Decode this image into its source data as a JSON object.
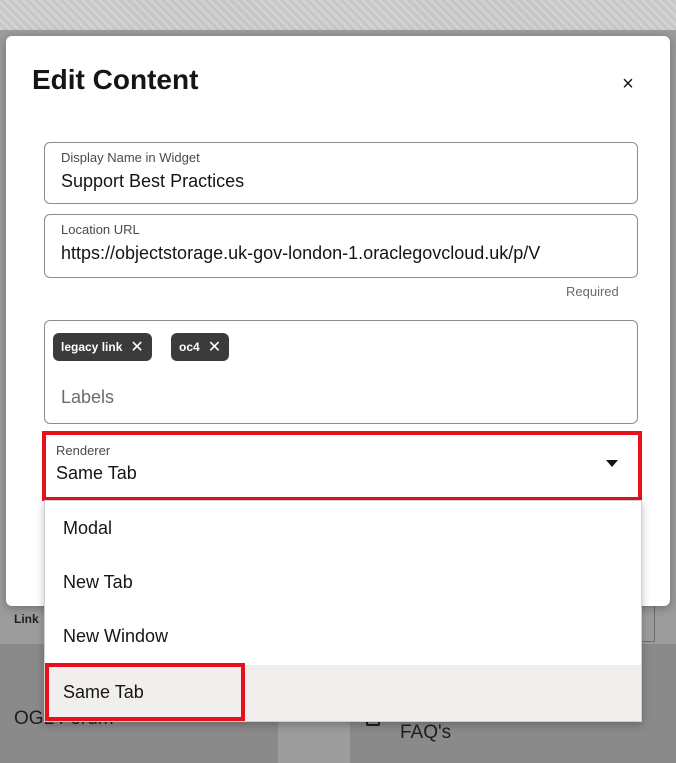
{
  "background": {
    "links_label": "Link",
    "card_left_text": "OGL Forum",
    "card_right_text": "FAQ's"
  },
  "dialog": {
    "title": "Edit Content",
    "close_glyph": "×",
    "display_name": {
      "label": "Display Name in Widget",
      "value": "Support Best Practices"
    },
    "location_url": {
      "label": "Location URL",
      "value": "https://objectstorage.uk-gov-london-1.oraclegovcloud.uk/p/V",
      "required_note": "Required"
    },
    "labels": {
      "chips": [
        {
          "text": "legacy link",
          "remove_glyph": "✕"
        },
        {
          "text": "oc4",
          "remove_glyph": "✕"
        }
      ],
      "placeholder": "Labels"
    },
    "renderer": {
      "label": "Renderer",
      "value": "Same Tab",
      "options": [
        "Modal",
        "New Tab",
        "New Window",
        "Same Tab"
      ]
    }
  },
  "colors": {
    "highlight": "#e8101b",
    "chip_bg": "#3c3b39",
    "selected_option_bg": "#f1efed"
  },
  "icons": {
    "close": "close-icon",
    "chip_remove": "chip-remove-icon",
    "dropdown_caret": "chevron-down-icon"
  }
}
